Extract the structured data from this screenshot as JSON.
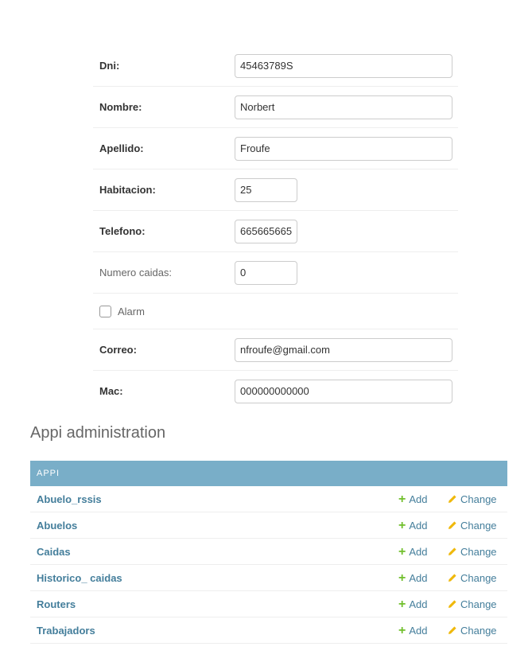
{
  "form": {
    "dni": {
      "label": "Dni:",
      "value": "45463789S"
    },
    "nombre": {
      "label": "Nombre:",
      "value": "Norbert"
    },
    "apellido": {
      "label": "Apellido:",
      "value": "Froufe"
    },
    "habitacion": {
      "label": "Habitacion:",
      "value": "25"
    },
    "telefono": {
      "label": "Telefono:",
      "value": "665665665"
    },
    "numero_caidas": {
      "label": "Numero caidas:",
      "value": "0"
    },
    "alarm": {
      "label": "Alarm",
      "checked": false
    },
    "correo": {
      "label": "Correo:",
      "value": "nfroufe@gmail.com"
    },
    "mac": {
      "label": "Mac:",
      "value": "000000000000"
    }
  },
  "admin": {
    "title": "Appi administration",
    "caption": "APPI",
    "add_label": "Add",
    "change_label": "Change",
    "models": [
      {
        "name": "Abuelo_rssis"
      },
      {
        "name": "Abuelos"
      },
      {
        "name": "Caidas"
      },
      {
        "name": "Historico_ caidas"
      },
      {
        "name": "Routers"
      },
      {
        "name": "Trabajadors"
      }
    ]
  },
  "colors": {
    "caption_bg": "#79aec8",
    "link": "#447e9b",
    "add_icon": "#70bf2b",
    "change_icon": "#efb80b"
  },
  "icons": {
    "add": "plus-icon",
    "change": "pencil-icon",
    "checkbox": "checkbox-unchecked"
  }
}
